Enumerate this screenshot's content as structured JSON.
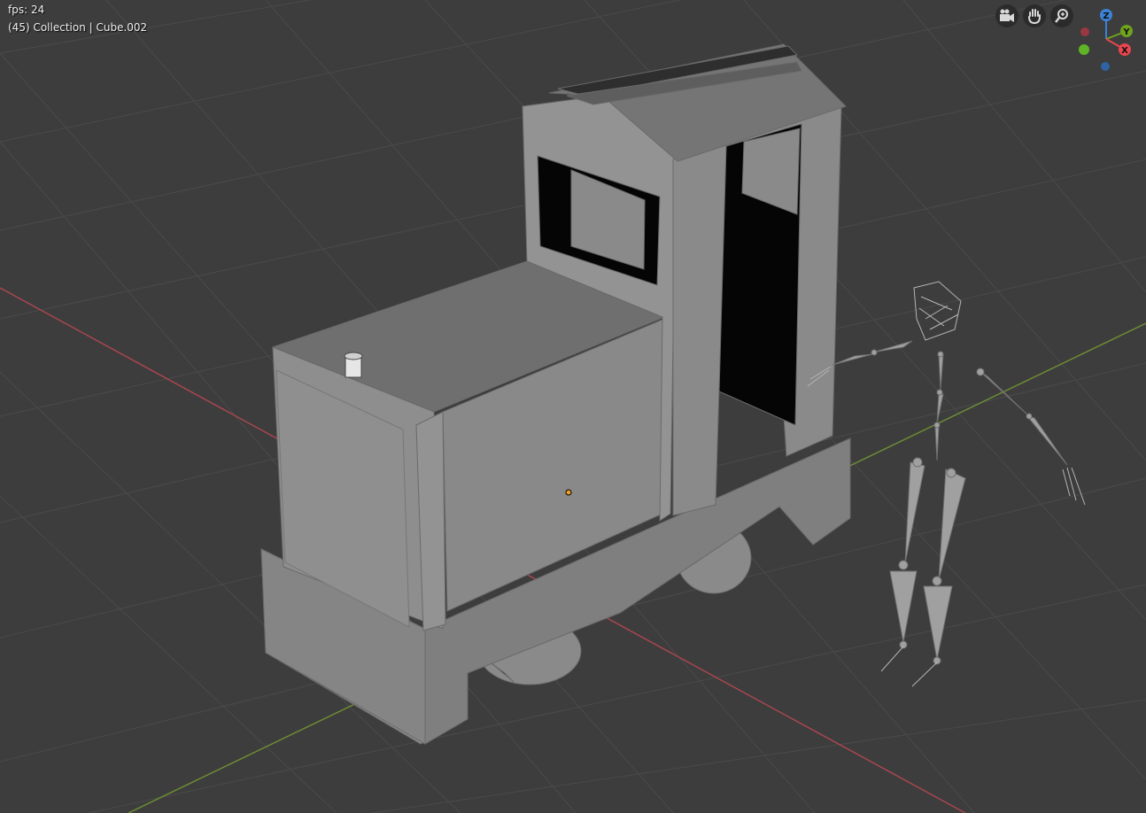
{
  "overlay": {
    "fps_text": "fps: 24",
    "collection_text": "(45) Collection | Cube.002"
  },
  "nav_buttons": [
    "camera-icon",
    "hand-pan-icon",
    "zoom-icon"
  ],
  "gizmo": {
    "z_label": "Z",
    "y_label": "Y",
    "x_label": "X",
    "colors": {
      "x": "#e8464f",
      "y": "#6fa21e",
      "z": "#3b83d6",
      "neg_x": "#9b3740",
      "neg_y": "#5fb326",
      "neg_z": "#2f63a3"
    }
  },
  "colors": {
    "background": "#3d3d3d",
    "grid": "#4a4a4a",
    "x_axis": "#a74650",
    "y_axis": "#6e8c34",
    "model": "#8f8f8f"
  }
}
